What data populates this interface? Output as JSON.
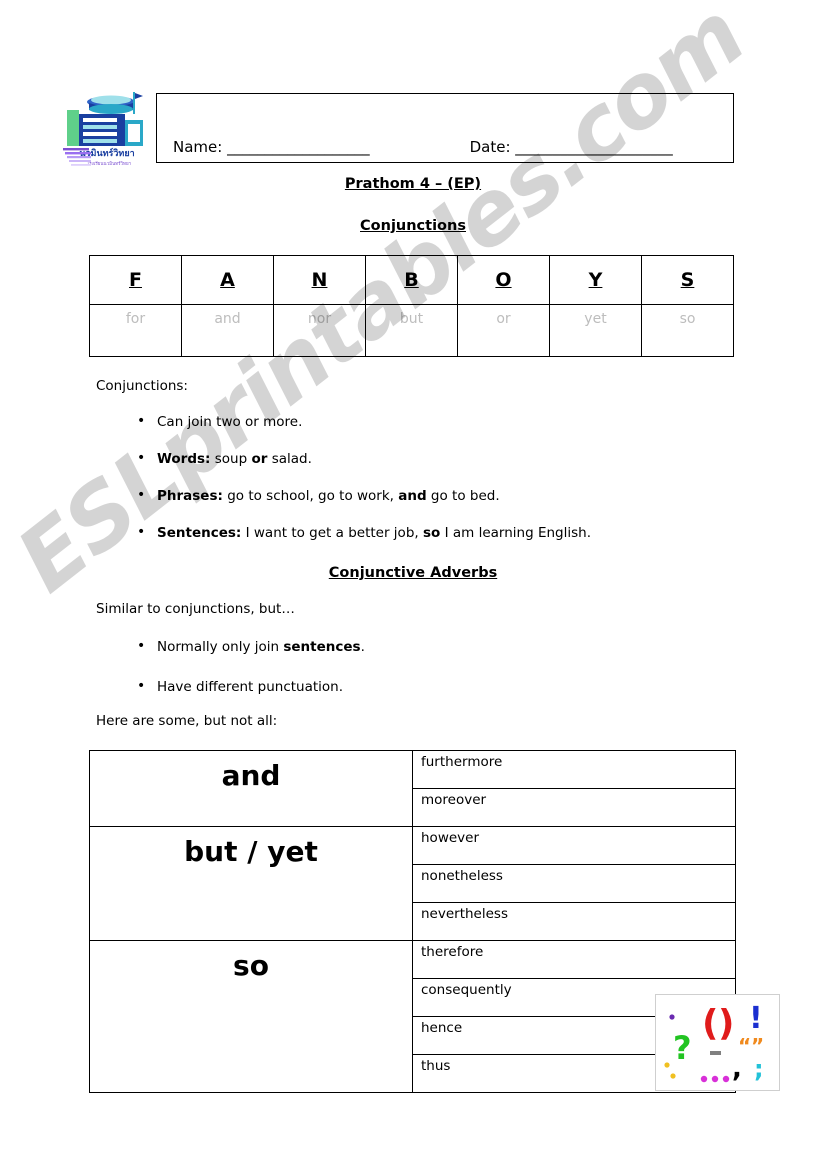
{
  "header": {
    "logo_alt": "school-logo",
    "logo_thai_main": "นวมินทร์วิทยา",
    "logo_thai_sub": "โรงเรียนนวมินทร์วิทยา",
    "name_label": "Name:",
    "name_blank": "___________________",
    "date_label": "Date:",
    "date_blank": "_____________________"
  },
  "titles": {
    "grade": "Prathom 4 – (EP)",
    "topic": "Conjunctions",
    "topic2": "Conjunctive Adverbs"
  },
  "fanboys": {
    "letters": [
      "F",
      "A",
      "N",
      "B",
      "O",
      "Y",
      "S"
    ],
    "words": [
      "for",
      "and",
      "nor",
      "but",
      "or",
      "yet",
      "so"
    ]
  },
  "conjunctions_section": {
    "label": "Conjunctions:",
    "bullets": [
      {
        "lead": "",
        "rest": "Can join two or more."
      },
      {
        "lead": "Words:",
        "rest": " soup ",
        "bold_mid": "or",
        "tail": " salad."
      },
      {
        "lead": "Phrases:",
        "rest": " go to school, go to work, ",
        "bold_mid": "and",
        "tail": " go to bed."
      },
      {
        "lead": "Sentences:",
        "rest": " I want to get a better job, ",
        "bold_mid": "so",
        "tail": " I am learning English."
      }
    ]
  },
  "adverbs_section": {
    "intro": "Similar to conjunctions, but…",
    "bullets": [
      {
        "rest": "Normally only join ",
        "bold_mid": "sentences",
        "tail": "."
      },
      {
        "rest": "Have different punctuation.",
        "bold_mid": "",
        "tail": ""
      }
    ],
    "here_are_some": "Here are some, but not all:"
  },
  "adverbs_table": {
    "groups": [
      {
        "conjunction": "and",
        "adverbs": [
          "furthermore",
          "moreover"
        ]
      },
      {
        "conjunction": "but / yet",
        "adverbs": [
          "however",
          "nonetheless",
          "nevertheless"
        ]
      },
      {
        "conjunction": "so",
        "adverbs": [
          "therefore",
          "consequently",
          "hence",
          "thus"
        ]
      }
    ]
  },
  "punctuation_clipart": {
    "name": "punctuation-marks-clipart",
    "marks": [
      "(",
      ")",
      "!",
      "?",
      "-",
      "“",
      "”",
      ",",
      ";",
      "..."
    ],
    "colors": {
      "parentheses": "#e01b1b",
      "exclamation": "#1b2fd0",
      "question": "#22c422",
      "dash": "#808080",
      "quotes": "#f08a1e",
      "comma": "#000000",
      "semicolon": "#22c2d8",
      "ellipsis": "#d830d8",
      "dot_purple": "#6a2ab0",
      "dot_yellow": "#f0c020"
    }
  },
  "watermark": {
    "text": "ESLprintables.com",
    "color": "#d9d9d9"
  },
  "logo_colors": {
    "blue": "#1a3fa0",
    "teal": "#2aa8c8",
    "green": "#5fd08a",
    "purple": "#7b4fd0"
  }
}
